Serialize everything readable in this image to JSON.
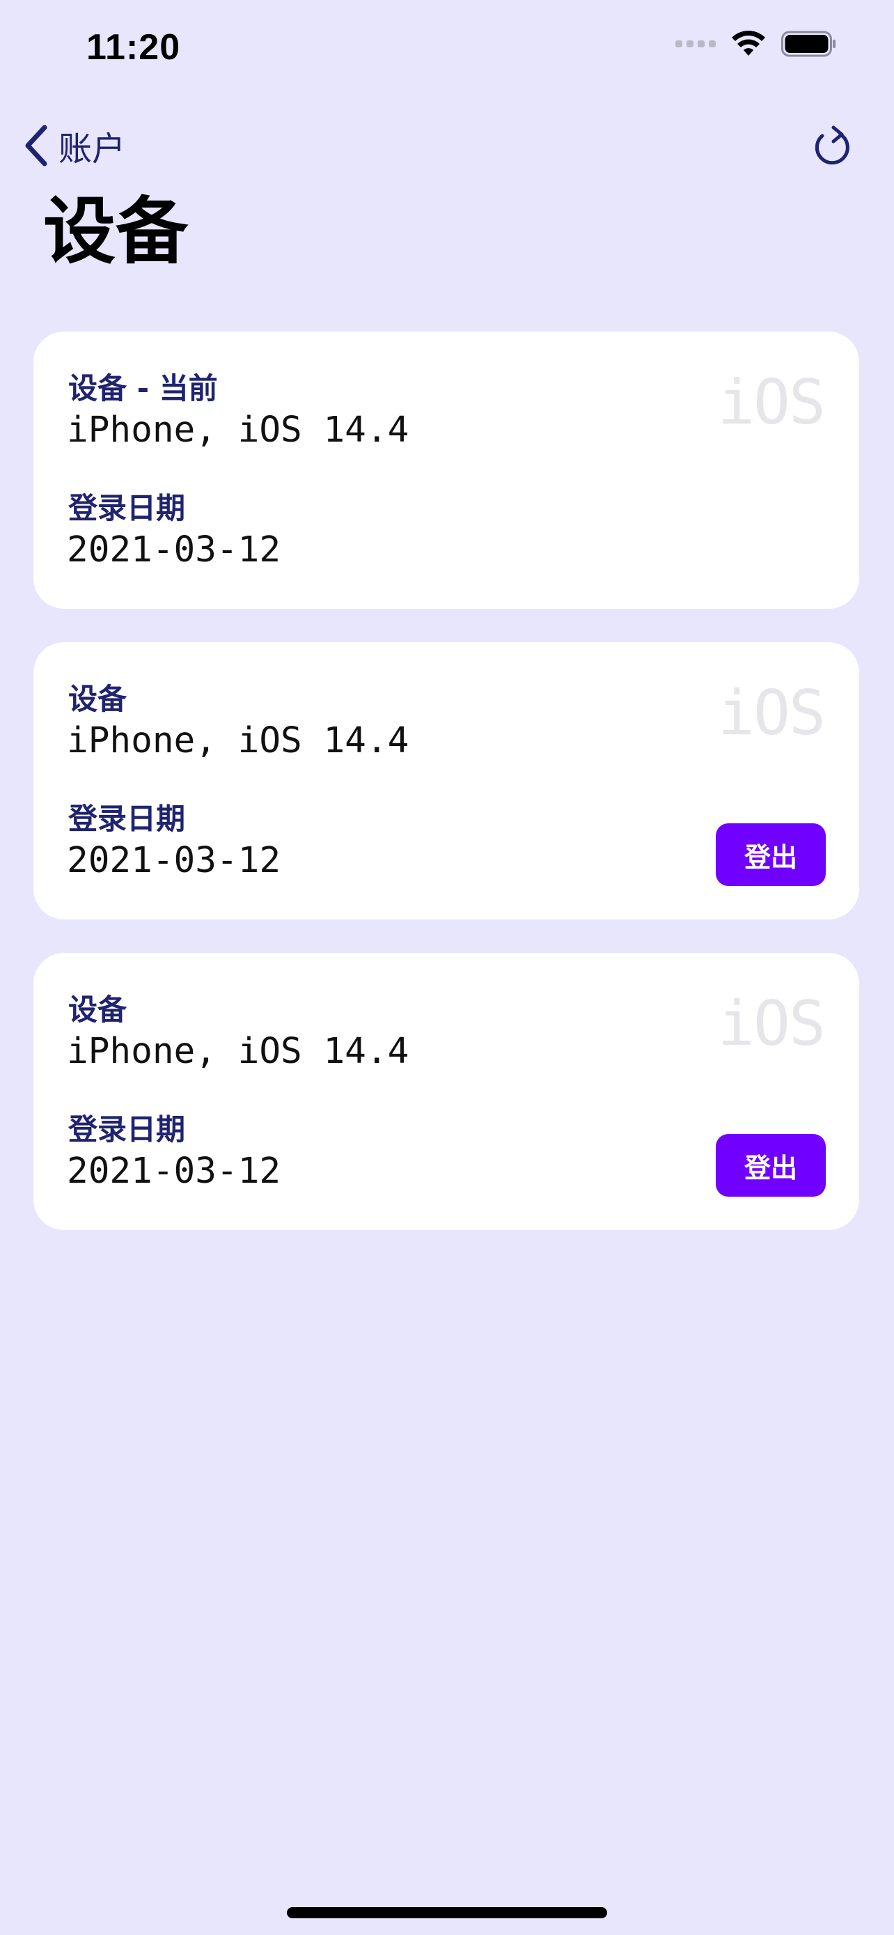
{
  "status_bar": {
    "time": "11:20"
  },
  "nav": {
    "back_label": "账户"
  },
  "page": {
    "title": "设备"
  },
  "devices": [
    {
      "device_label": "设备 - 当前",
      "device_value": "iPhone, iOS 14.4",
      "date_label": "登录日期",
      "date_value": "2021-03-12",
      "os_badge": "iOS",
      "logout_label": null
    },
    {
      "device_label": "设备",
      "device_value": "iPhone, iOS 14.4",
      "date_label": "登录日期",
      "date_value": "2021-03-12",
      "os_badge": "iOS",
      "logout_label": "登出"
    },
    {
      "device_label": "设备",
      "device_value": "iPhone, iOS 14.4",
      "date_label": "登录日期",
      "date_value": "2021-03-12",
      "os_badge": "iOS",
      "logout_label": "登出"
    }
  ],
  "colors": {
    "background": "#e8e6fd",
    "card": "#ffffff",
    "label": "#1f2370",
    "accent": "#7000ff",
    "watermark": "#e6e6ea"
  },
  "icons": {
    "back": "chevron-left-icon",
    "refresh": "refresh-icon",
    "wifi": "wifi-icon",
    "battery": "battery-icon",
    "cellular": "cellular-signal-icon"
  }
}
